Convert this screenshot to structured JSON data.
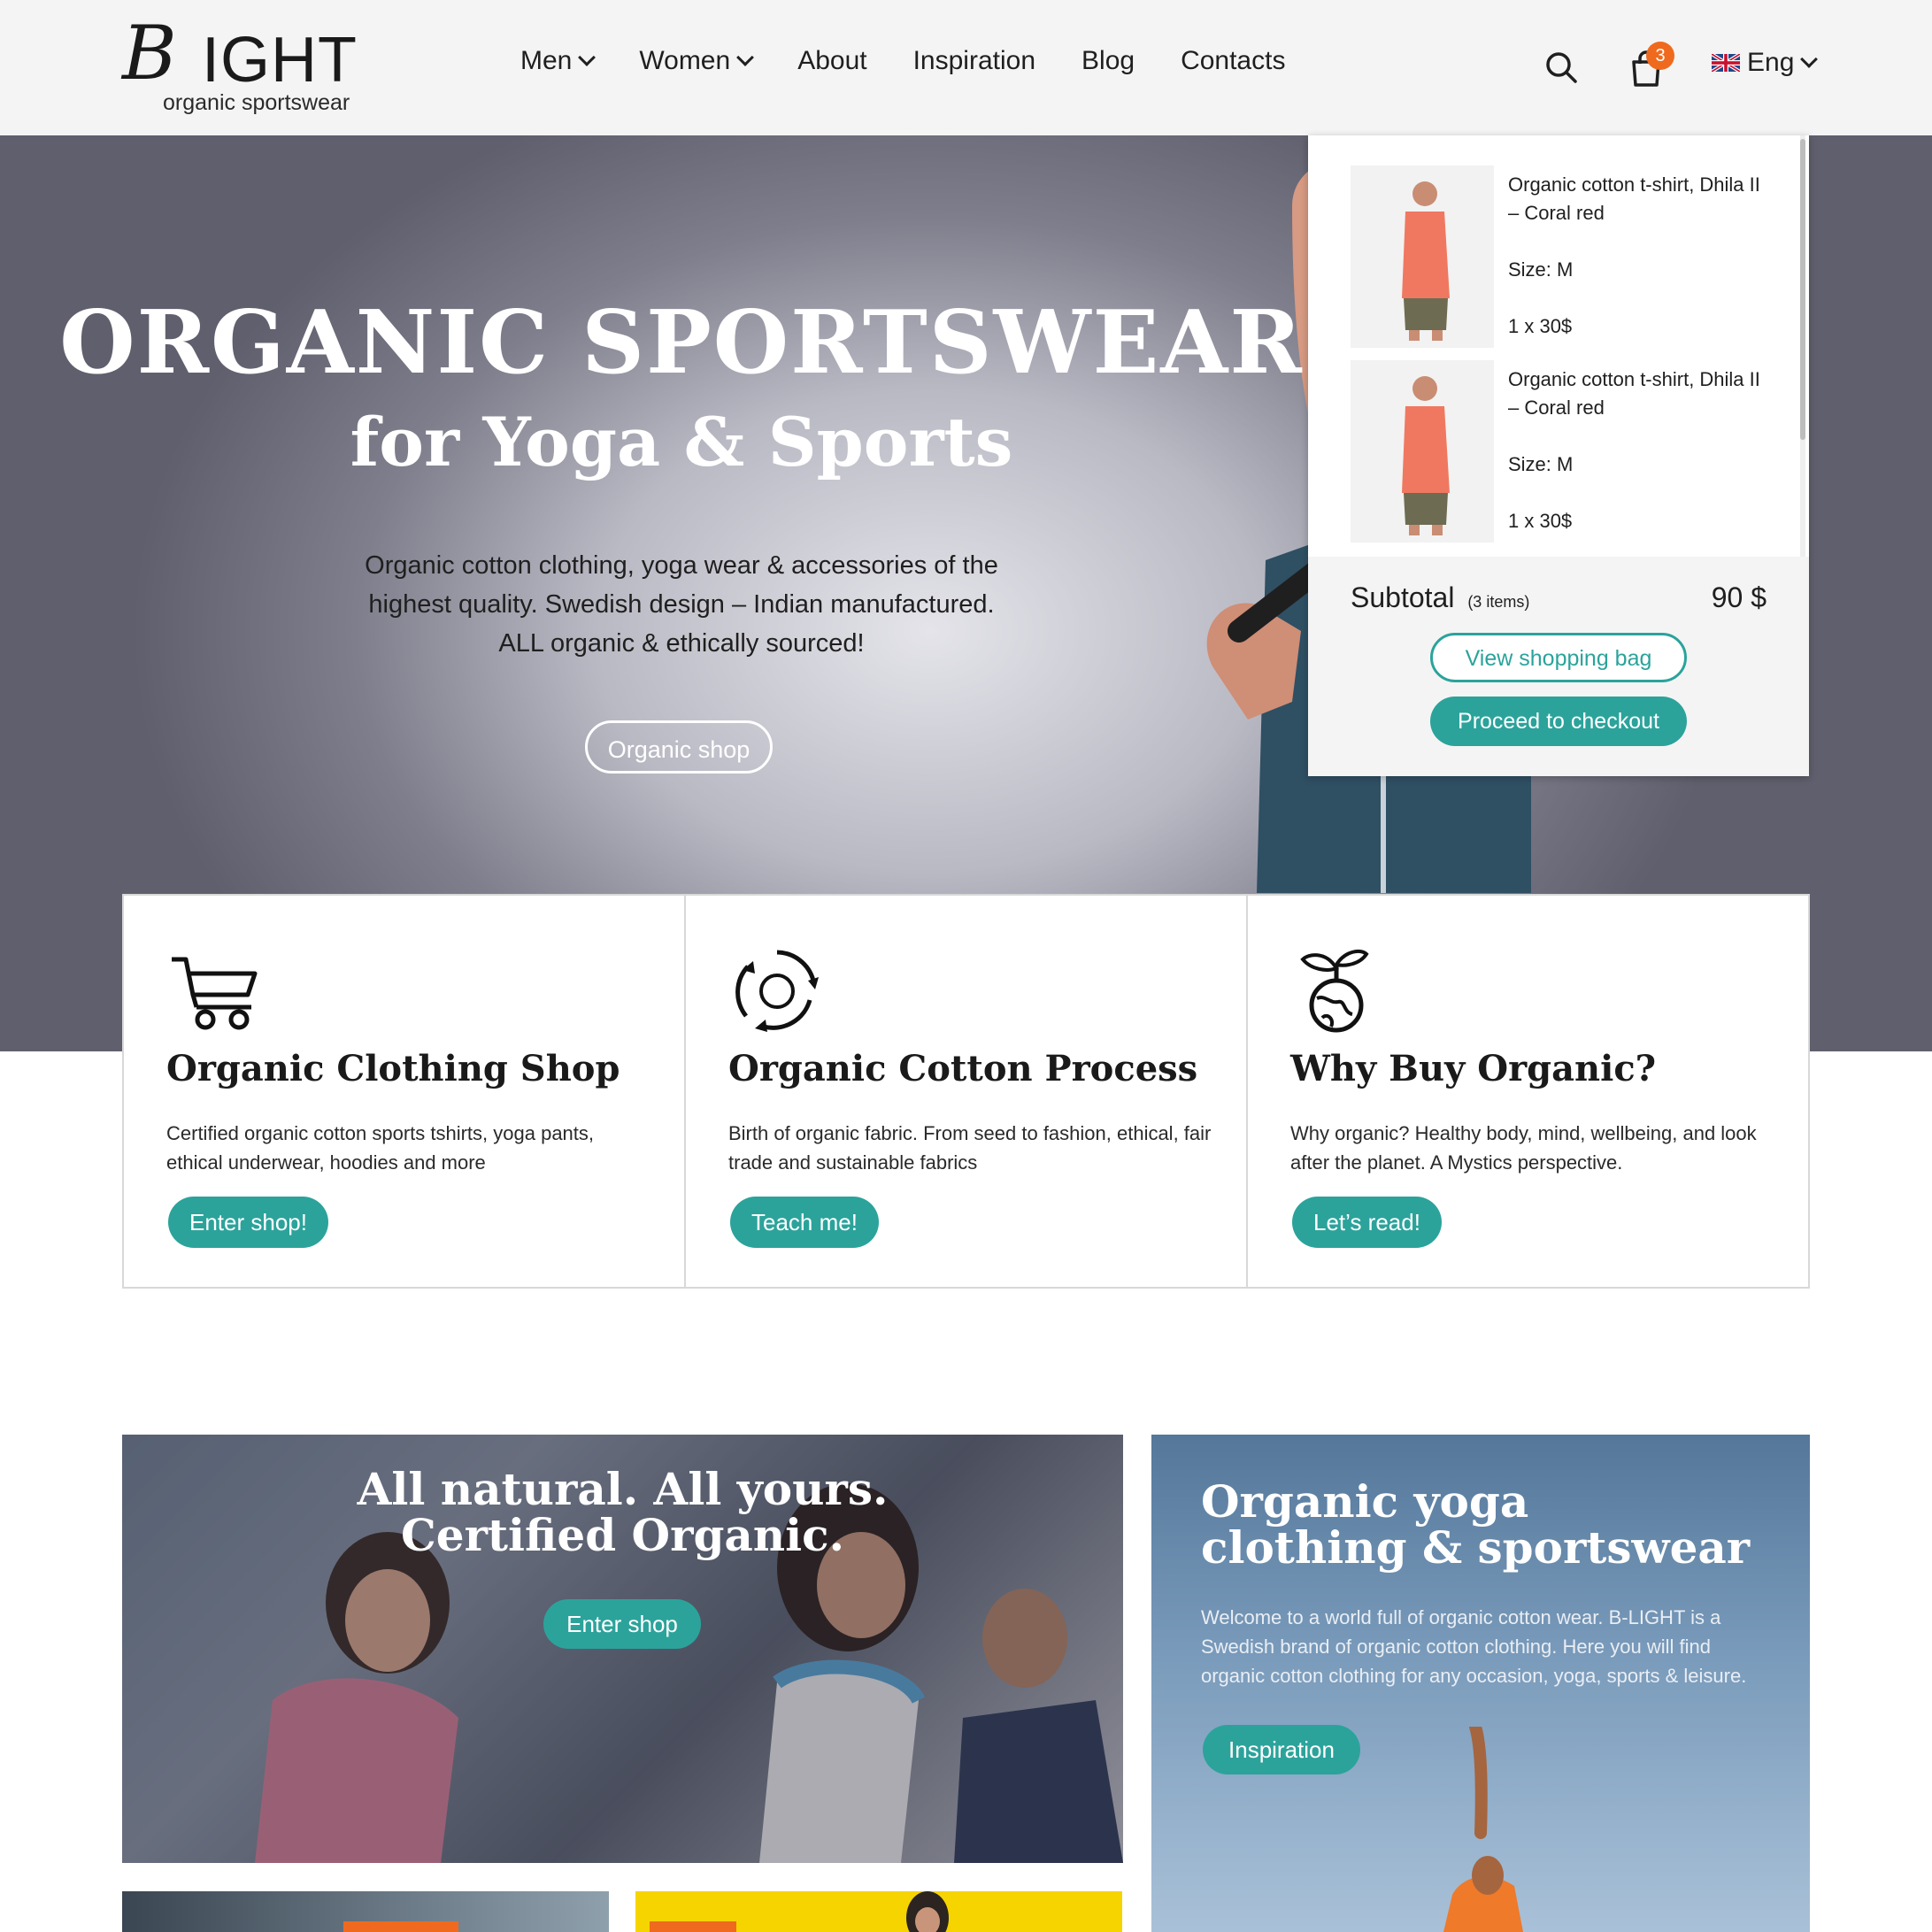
{
  "brand": {
    "mark": "B",
    "word": "IGHT",
    "tagline": "organic sportswear"
  },
  "nav": {
    "men": "Men",
    "women": "Women",
    "about": "About",
    "inspiration": "Inspiration",
    "blog": "Blog",
    "contacts": "Contacts"
  },
  "header": {
    "cart_count": "3",
    "language": "Eng"
  },
  "hero": {
    "title": "ORGANIC SPORTSWEAR",
    "subtitle": "for Yoga & Sports",
    "desc_line1": "Organic cotton clothing, yoga wear & accessories of the",
    "desc_line2": "highest quality. Swedish design – Indian manufactured.",
    "desc_line3": "ALL organic & ethically sourced!",
    "cta": "Organic shop"
  },
  "minicart": {
    "items": [
      {
        "name_line1": "Organic cotton t-shirt, Dhila II",
        "name_line2": "– Coral red",
        "size": "Size: M",
        "qty_price": "1 x 30$"
      },
      {
        "name_line1": "Organic cotton t-shirt, Dhila II",
        "name_line2": "– Coral red",
        "size": "Size: M",
        "qty_price": "1 x 30$"
      }
    ],
    "subtotal_label": "Subtotal",
    "items_count": "(3 items)",
    "total": "90 $",
    "view_bag": "View shopping bag",
    "checkout": "Proceed to checkout"
  },
  "features": [
    {
      "title": "Organic Clothing Shop",
      "desc_line1": "Certified organic cotton sports tshirts, yoga pants,",
      "desc_line2": "ethical underwear, hoodies and more",
      "button": "Enter shop!",
      "icon": "shopping-cart-icon"
    },
    {
      "title": "Organic Cotton Process",
      "desc_line1": "Birth of organic fabric. From seed to fashion, ethical, fair",
      "desc_line2": "trade and sustainable fabrics",
      "button": "Teach me!",
      "icon": "recycle-cycle-icon"
    },
    {
      "title": "Why Buy Organic?",
      "desc_line1": "Why organic? Healthy body, mind, wellbeing, and look",
      "desc_line2": "after the planet. A Mystics perspective.",
      "button": "Let’s read!",
      "icon": "planet-sprout-icon"
    }
  ],
  "promo_left": {
    "title_line1": "All natural. All yours.",
    "title_line2": "Certified Organic.",
    "button": "Enter shop"
  },
  "promo_right": {
    "title_line1": "Organic yoga",
    "title_line2": "clothing & sportswear",
    "desc_line1": "Welcome to a world full of organic cotton wear. B-LIGHT is a",
    "desc_line2": "Swedish brand of organic cotton clothing. Here you will find",
    "desc_line3": "organic cotton clothing for any occasion, yoga, sports & leisure.",
    "button": "Inspiration"
  },
  "colors": {
    "accent": "#2ba39b",
    "badge": "#ef6a1e",
    "header_bg": "#f4f4f4"
  }
}
